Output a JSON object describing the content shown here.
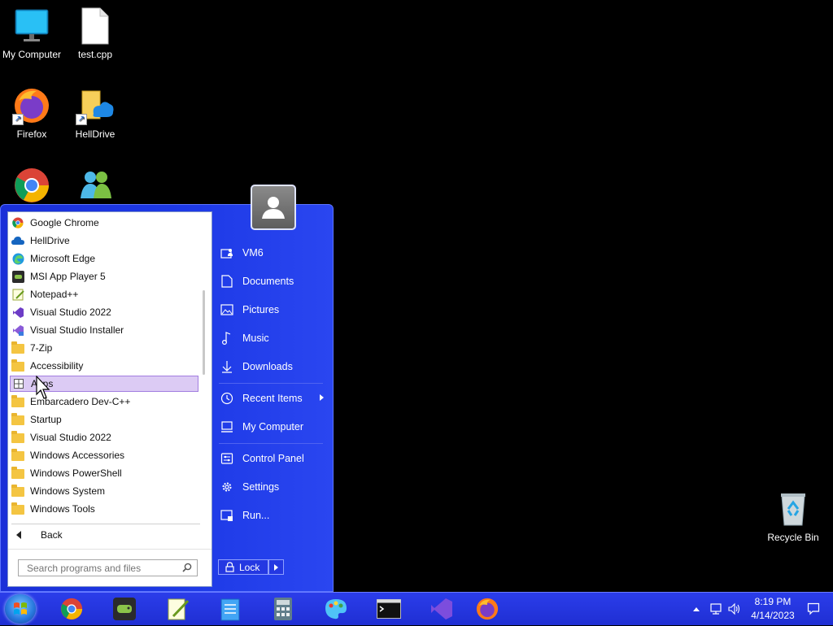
{
  "desktop": {
    "icons": [
      {
        "label": "My Computer"
      },
      {
        "label": "test.cpp"
      },
      {
        "label": "Firefox"
      },
      {
        "label": "HellDrive"
      },
      {
        "label": "Recycle Bin"
      }
    ]
  },
  "start_menu": {
    "programs": [
      {
        "label": "Google Chrome",
        "icon": "chrome-icon"
      },
      {
        "label": "HellDrive",
        "icon": "cloud-icon"
      },
      {
        "label": "Microsoft Edge",
        "icon": "edge-icon"
      },
      {
        "label": "MSI App Player 5",
        "icon": "msi-app-player-icon"
      },
      {
        "label": "Notepad++",
        "icon": "notepad-plus-icon"
      },
      {
        "label": "Visual Studio 2022",
        "icon": "visual-studio-icon"
      },
      {
        "label": "Visual Studio Installer",
        "icon": "visual-studio-installer-icon"
      },
      {
        "label": "7-Zip",
        "icon": "folder-icon"
      },
      {
        "label": "Accessibility",
        "icon": "folder-icon"
      },
      {
        "label": "Apps",
        "icon": "apps-icon"
      },
      {
        "label": "Embarcadero Dev-C++",
        "icon": "folder-icon"
      },
      {
        "label": "Startup",
        "icon": "folder-icon"
      },
      {
        "label": "Visual Studio 2022",
        "icon": "folder-icon"
      },
      {
        "label": "Windows Accessories",
        "icon": "folder-icon"
      },
      {
        "label": "Windows PowerShell",
        "icon": "folder-icon"
      },
      {
        "label": "Windows System",
        "icon": "folder-icon"
      },
      {
        "label": "Windows Tools",
        "icon": "folder-icon"
      }
    ],
    "back_label": "Back",
    "search_placeholder": "Search programs and files",
    "right_items": [
      {
        "label": "VM6"
      },
      {
        "label": "Documents"
      },
      {
        "label": "Pictures"
      },
      {
        "label": "Music"
      },
      {
        "label": "Downloads"
      },
      {
        "label": "Recent Items"
      },
      {
        "label": "My Computer"
      },
      {
        "label": "Control Panel"
      },
      {
        "label": "Settings"
      },
      {
        "label": "Run..."
      }
    ],
    "lock_label": "Lock"
  },
  "taskbar": {
    "time": "8:19 PM",
    "date": "4/14/2023"
  },
  "colors": {
    "menu_blue": "#1d39e6",
    "highlight": "#dccbf4"
  }
}
